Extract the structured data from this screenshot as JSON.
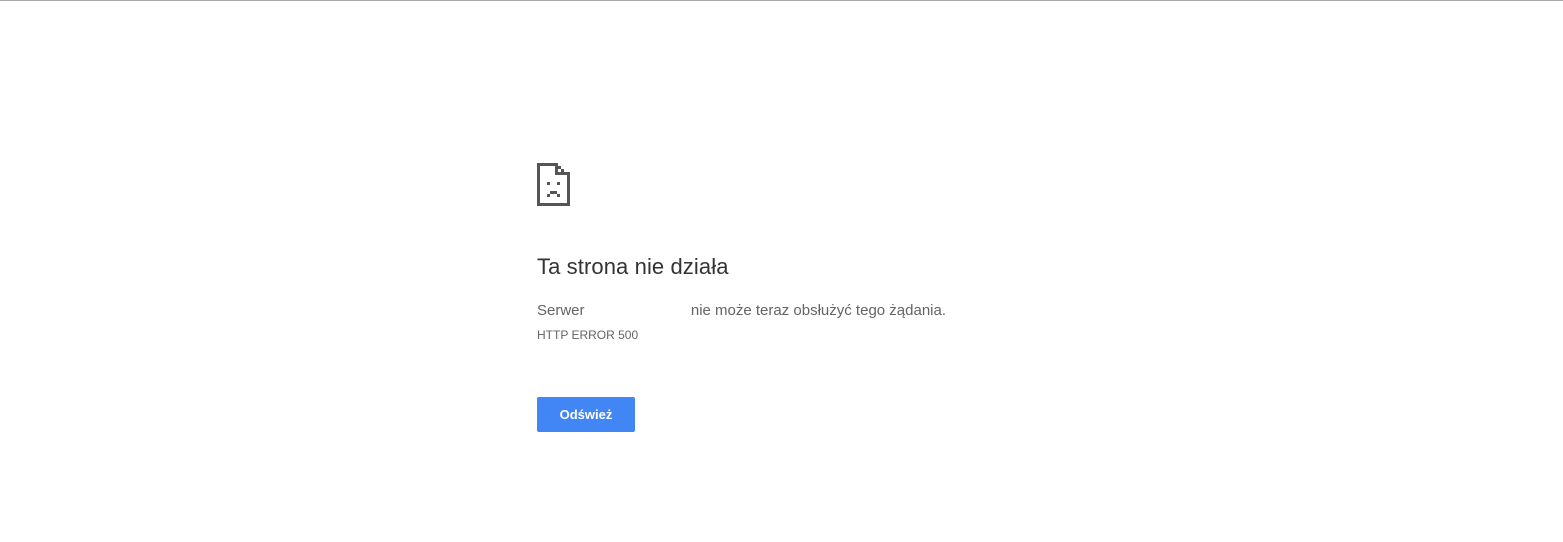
{
  "error_page": {
    "icon": "sad-document-icon",
    "title": "Ta strona nie działa",
    "message_prefix": "Serwer",
    "message_suffix": "nie może teraz obsłużyć tego żądania.",
    "error_code": "HTTP ERROR 500",
    "reload_label": "Odśwież",
    "button_color": "#4285f4"
  }
}
